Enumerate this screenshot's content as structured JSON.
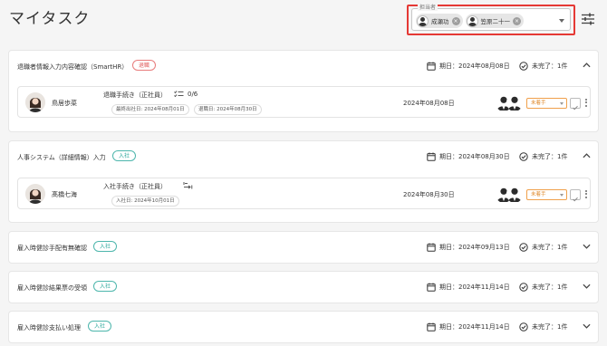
{
  "page": {
    "title": "マイタスク"
  },
  "assignee_filter": {
    "label": "担当者",
    "chips": [
      {
        "name": "成瀬功"
      },
      {
        "name": "笠原二十一"
      }
    ]
  },
  "sections": [
    {
      "title": "退職者情報入力内容確認（SmartHR）",
      "tag": "退職",
      "due": "期日：2024年08月08日",
      "incomplete": "未完了：1件",
      "expanded": true,
      "task": {
        "person": "鳥居歩菜",
        "procedure": "退職手続き（正社員）",
        "progress": "0/6",
        "dates": [
          "最終出社日: 2024年08月01日",
          "退職日: 2024年08月30日"
        ],
        "date": "2024年08月08日",
        "status": "未着手"
      }
    },
    {
      "title": "人事システム（詳細情報）入力",
      "tag": "入社",
      "due": "期日：2024年08月30日",
      "incomplete": "未完了：1件",
      "expanded": true,
      "task": {
        "person": "髙橋七海",
        "procedure": "入社手続き（正社員）",
        "dates": [
          "入社日: 2024年10月01日"
        ],
        "date": "2024年08月30日",
        "status": "未着手"
      }
    },
    {
      "title": "雇入時健診手配有無確認",
      "tag": "入社",
      "due": "期日：2024年09月13日",
      "incomplete": "未完了：1件",
      "expanded": false
    },
    {
      "title": "雇入時健診結果票の受領",
      "tag": "入社",
      "due": "期日：2024年11月14日",
      "incomplete": "未完了：1件",
      "expanded": false
    },
    {
      "title": "雇入時健診支払い処理",
      "tag": "入社",
      "due": "期日：2024年11月14日",
      "incomplete": "未完了：1件",
      "expanded": false
    }
  ],
  "colors": {
    "red_tag": "#e05a5a",
    "teal_tag": "#26a69a",
    "status_orange": "#e08a2c",
    "highlight": "#e53935"
  }
}
